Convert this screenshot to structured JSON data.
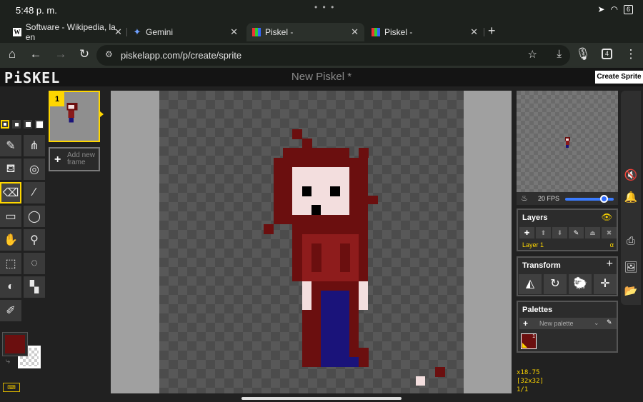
{
  "status_bar": {
    "time": "5:48 p. m.",
    "battery": "6"
  },
  "tabs": [
    {
      "title": "Software - Wikipedia, la en",
      "favicon": "W"
    },
    {
      "title": "Gemini",
      "favicon": "gemini-icon"
    },
    {
      "title": "Piskel -",
      "favicon": "piskel-icon",
      "active": true
    },
    {
      "title": "Piskel -",
      "favicon": "piskel-icon"
    }
  ],
  "browser": {
    "url": "piskelapp.com/p/create/sprite",
    "tab_count": "4"
  },
  "app": {
    "logo": "PiSKEL",
    "document_title": "New Piskel *",
    "create_button": "Create Sprite"
  },
  "frames": {
    "current": "1",
    "add_label": "Add new frame"
  },
  "colors": {
    "primary": "#6b0f0f",
    "secondary": "transparent",
    "accent": "#ffd700"
  },
  "preview": {
    "fps": "20 FPS",
    "fps_level": 0.9
  },
  "layers": {
    "title": "Layers",
    "layer_name": "Layer 1",
    "alpha": "α"
  },
  "transform": {
    "title": "Transform"
  },
  "palettes": {
    "title": "Palettes",
    "new_label": "New palette",
    "swatch_index": "1"
  },
  "status": {
    "zoom": "x18.75",
    "size": "[32x32]",
    "frame": "1/1"
  }
}
